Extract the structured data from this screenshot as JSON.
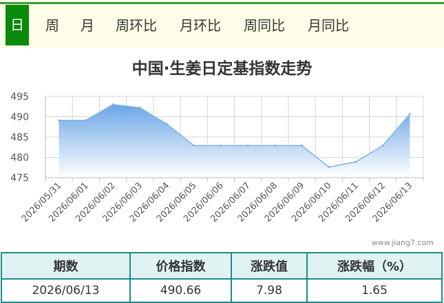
{
  "tabs": [
    {
      "label": "日",
      "active": true
    },
    {
      "label": "周",
      "active": false
    },
    {
      "label": "月",
      "active": false
    },
    {
      "label": "周环比",
      "active": false
    },
    {
      "label": "月环比",
      "active": false
    },
    {
      "label": "周同比",
      "active": false
    },
    {
      "label": "月同比",
      "active": false
    }
  ],
  "chart_data": {
    "type": "area",
    "title": "中国·生姜日定基指数走势",
    "xlabel": "",
    "ylabel": "",
    "x": [
      "2026/05/31",
      "2026/06/01",
      "2026/06/02",
      "2026/06/03",
      "2026/06/04",
      "2026/06/05",
      "2026/06/06",
      "2026/06/07",
      "2026/06/08",
      "2026/06/09",
      "2026/06/10",
      "2026/06/11",
      "2026/06/12",
      "2026/06/13"
    ],
    "values": [
      489.1,
      489.1,
      493.0,
      492.2,
      488.2,
      482.9,
      482.9,
      482.9,
      482.9,
      482.9,
      477.6,
      478.9,
      482.9,
      490.66
    ],
    "ylim": [
      475,
      495
    ],
    "yticks": [
      475,
      480,
      485,
      490,
      495
    ],
    "grid": true,
    "line_color": "#7fb2e5",
    "fill_top": "#6aa6e6",
    "fill_bottom": "#ffffff"
  },
  "watermark": "www.jiang7.com",
  "summary": {
    "headers": [
      "期数",
      "价格指数",
      "涨跌值",
      "涨跌幅（%）"
    ],
    "row": [
      "2026/06/13",
      "490.66",
      "7.98",
      "1.65"
    ]
  }
}
